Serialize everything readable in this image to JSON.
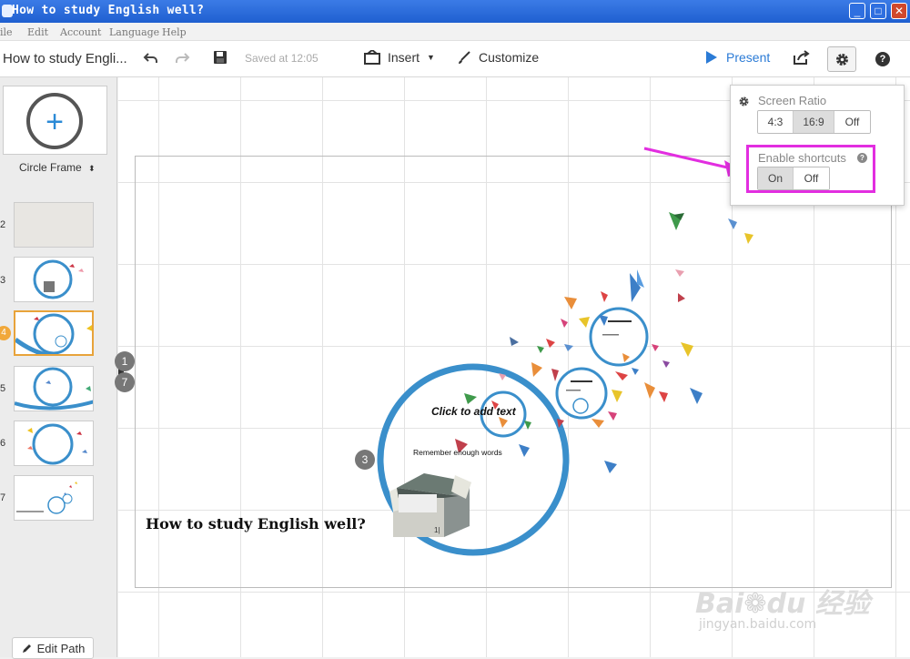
{
  "window": {
    "title": "How to study English well?",
    "minimize": "_",
    "maximize": "□",
    "close": "✕"
  },
  "menu": {
    "items": [
      "ile",
      "Edit",
      "Account",
      "Language",
      "Help"
    ]
  },
  "toolbar": {
    "doc_title": "How to study Engli...",
    "saved": "Saved at 12:05",
    "insert": "Insert",
    "customize": "Customize",
    "present": "Present",
    "help": "?"
  },
  "sidebar": {
    "frame_type": "Circle Frame",
    "slides": [
      "2",
      "3",
      "4",
      "5",
      "6",
      "7"
    ],
    "active_slide": "4",
    "edit_path": "Edit Path"
  },
  "settings_popup": {
    "screen_ratio_label": "Screen Ratio",
    "ratio_options": [
      "4:3",
      "16:9",
      "Off"
    ],
    "ratio_selected": "16:9",
    "shortcuts_label": "Enable shortcuts",
    "shortcut_options": [
      "On",
      "Off"
    ],
    "shortcut_selected": "On",
    "help": "?"
  },
  "canvas": {
    "title": "How to study English well?",
    "click_to_add": "Click to add text",
    "remember": "Remember enough words",
    "path_markers": [
      "1",
      "7",
      "3"
    ],
    "box_label": "1|"
  },
  "watermark": {
    "logo": "Bai du 经验",
    "url": "jingyan.baidu.com"
  },
  "colors": {
    "accent": "#2b7bd6",
    "circle": "#3a8fcb",
    "highlight": "#e22ee0",
    "active_thumb": "#e8a33a"
  }
}
